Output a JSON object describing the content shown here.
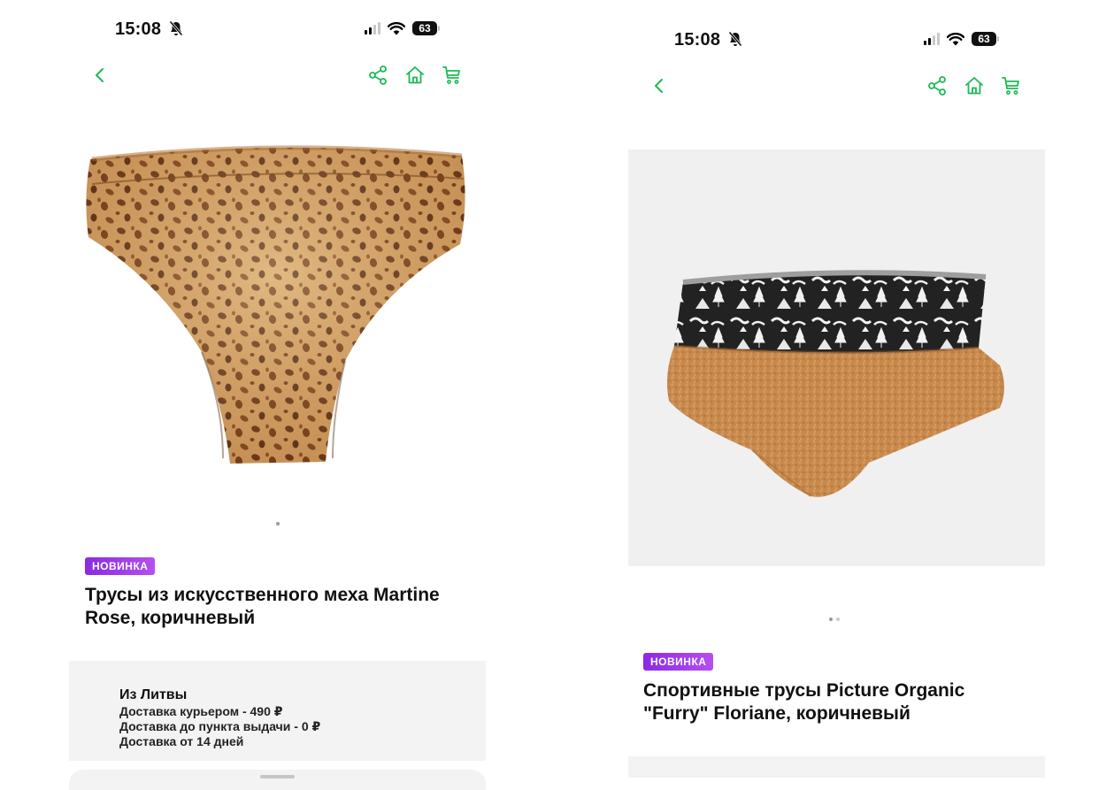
{
  "colors": {
    "accent": "#1db954",
    "badge": "#9b3ee8",
    "panel": "#f3f3f3"
  },
  "screens": [
    {
      "status": {
        "time": "15:08",
        "battery": "63",
        "icons": [
          "bell-slash-icon",
          "cellular-icon",
          "wifi-icon",
          "battery-icon"
        ]
      },
      "nav": {
        "icons": [
          "back-chevron-icon",
          "share-icon",
          "home-icon",
          "cart-icon"
        ]
      },
      "image": {
        "alt": "leopard print faux fur briefs"
      },
      "carousel": {
        "count": 1,
        "active": 1
      },
      "product": {
        "badge": "НОВИНКА",
        "title_line1": "Трусы из искусственного меха Martine",
        "title_line2": "Rose, коричневый"
      },
      "delivery": {
        "origin": "Из Литвы",
        "courier": "Доставка курьером - 490 ₽",
        "pickup": "Доставка до пункта выдачи - 0 ₽",
        "time": "Доставка от 14 дней"
      }
    },
    {
      "status": {
        "time": "15:08",
        "battery": "63",
        "icons": [
          "bell-slash-icon",
          "cellular-icon",
          "wifi-icon",
          "battery-icon"
        ]
      },
      "nav": {
        "icons": [
          "back-chevron-icon",
          "share-icon",
          "home-icon",
          "cart-icon"
        ]
      },
      "image": {
        "alt": "brown fleece briefs with patterned waistband"
      },
      "carousel": {
        "count": 2,
        "active": 1
      },
      "product": {
        "badge": "НОВИНКА",
        "title_line1": "Спортивные трусы Picture Organic",
        "title_line2": "\"Furry\" Floriane, коричневый"
      }
    }
  ]
}
